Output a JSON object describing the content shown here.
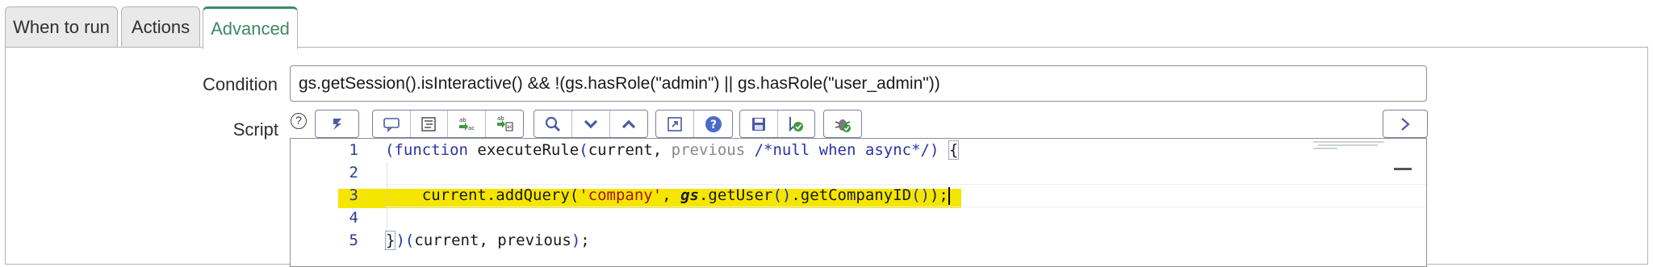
{
  "tabs": [
    {
      "label": "When to run",
      "active": false
    },
    {
      "label": "Actions",
      "active": false
    },
    {
      "label": "Advanced",
      "active": true
    }
  ],
  "condition": {
    "label": "Condition",
    "value": "gs.getSession().isInteractive() && !(gs.hasRole(\"admin\") || gs.hasRole(\"user_admin\"))"
  },
  "script": {
    "label": "Script",
    "help_glyph": "?",
    "toolbar_icons": [
      "format-code-icon",
      "comment-icon",
      "format-icon",
      "replace-icon",
      "replace-all-icon",
      "search-icon",
      "toggle-down-icon",
      "toggle-up-icon",
      "fullscreen-icon",
      "help-icon",
      "save-icon",
      "script-debug-icon",
      "debug-icon",
      "expand-icon"
    ],
    "lines": [
      {
        "num": "1",
        "tokens": [
          "(",
          "function",
          " executeRule",
          "(",
          "current, ",
          "previous",
          " /*null when async*/",
          ")",
          " ",
          "{"
        ]
      },
      {
        "num": "2",
        "tokens": []
      },
      {
        "num": "3",
        "tokens": [
          "    current.addQuery(",
          "'company'",
          ", ",
          "gs",
          ".getUser",
          "()",
          ".getCompanyID",
          "()",
          ")",
          ";"
        ]
      },
      {
        "num": "4",
        "tokens": []
      },
      {
        "num": "5",
        "tokens": [
          "}",
          ")(",
          "current, previous",
          ")",
          ";"
        ]
      }
    ],
    "highlighted_line": "3"
  },
  "colors": {
    "accent": "#3e8a63",
    "highlight": "#f5e600",
    "keyword": "#2b33a6"
  }
}
